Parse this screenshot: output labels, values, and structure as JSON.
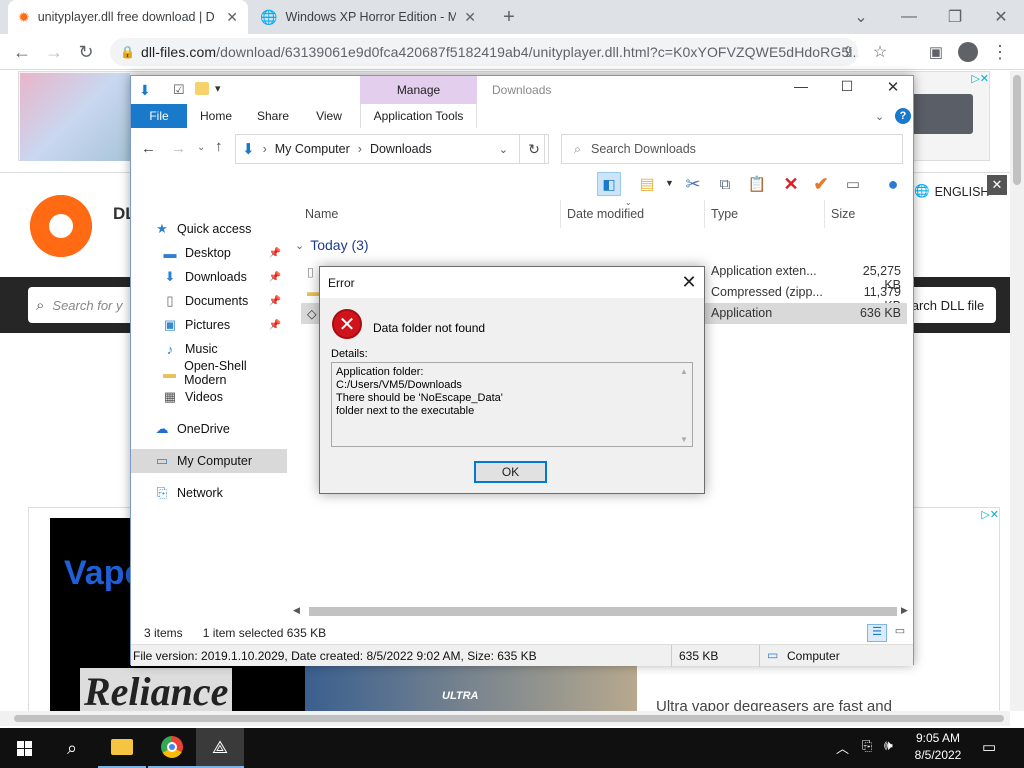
{
  "browser": {
    "tabs": [
      {
        "title": "unityplayer.dll free download | D",
        "active": true
      },
      {
        "title": "Windows XP Horror Edition - Ma",
        "active": false
      }
    ],
    "url_main": "dll-files.com",
    "url_rest": "/download/63139061e9d0fca420687f5182419ab4/unityplayer.dll.html?c=K0xYOFVZQWE5dHdoRG5i..."
  },
  "website": {
    "logo_text": "DL",
    "search_placeholder": "Search for y",
    "search_button": "arch DLL file",
    "language": "ENGLISH",
    "ad_text_1": "Vape",
    "ad_text_2": "Reliance",
    "ad_text_3": "ULTRA",
    "ad_caption": "Ultra vapor degreasers are fast and"
  },
  "explorer": {
    "title": "Downloads",
    "ribbon_tabs": [
      "File",
      "Home",
      "Share",
      "View",
      "Application Tools"
    ],
    "manage_label": "Manage",
    "breadcrumb": [
      "My Computer",
      "Downloads"
    ],
    "search_placeholder": "Search Downloads",
    "nav": [
      {
        "label": "Quick access",
        "icon": "star-icon",
        "pinned": false
      },
      {
        "label": "Desktop",
        "icon": "desktop-icon",
        "pinned": true
      },
      {
        "label": "Downloads",
        "icon": "downloads-icon",
        "pinned": true
      },
      {
        "label": "Documents",
        "icon": "documents-icon",
        "pinned": true
      },
      {
        "label": "Pictures",
        "icon": "pictures-icon",
        "pinned": true
      },
      {
        "label": "Music",
        "icon": "music-icon",
        "pinned": false
      },
      {
        "label": "Open-Shell Modern",
        "icon": "folder-icon",
        "pinned": false
      },
      {
        "label": "Videos",
        "icon": "videos-icon",
        "pinned": false
      },
      {
        "label": "OneDrive",
        "icon": "cloud-icon",
        "pinned": false
      },
      {
        "label": "My Computer",
        "icon": "computer-icon",
        "pinned": false
      },
      {
        "label": "Network",
        "icon": "network-icon",
        "pinned": false
      }
    ],
    "columns": [
      "Name",
      "Date modified",
      "Type",
      "Size"
    ],
    "group": "Today (3)",
    "files": [
      {
        "type": "Application exten...",
        "size": "25,275 KB"
      },
      {
        "type": "Compressed (zipp...",
        "size": "11,379 KB"
      },
      {
        "type": "Application",
        "size": "636 KB"
      }
    ],
    "status_items": "3 items",
    "status_selected": "1 item selected  635 KB",
    "info_text": "File version: 2019.1.10.2029, Date created: 8/5/2022 9:02 AM, Size: 635 KB",
    "info_size": "635 KB",
    "info_location": "Computer"
  },
  "dialog": {
    "title": "Error",
    "message": "Data folder not found",
    "details_label": "Details:",
    "details_lines": [
      "Application folder:",
      "C:/Users/VM5/Downloads",
      "There should be 'NoEscape_Data'",
      "folder next to the executable"
    ],
    "ok_label": "OK"
  },
  "taskbar": {
    "time": "9:05 AM",
    "date": "8/5/2022"
  }
}
